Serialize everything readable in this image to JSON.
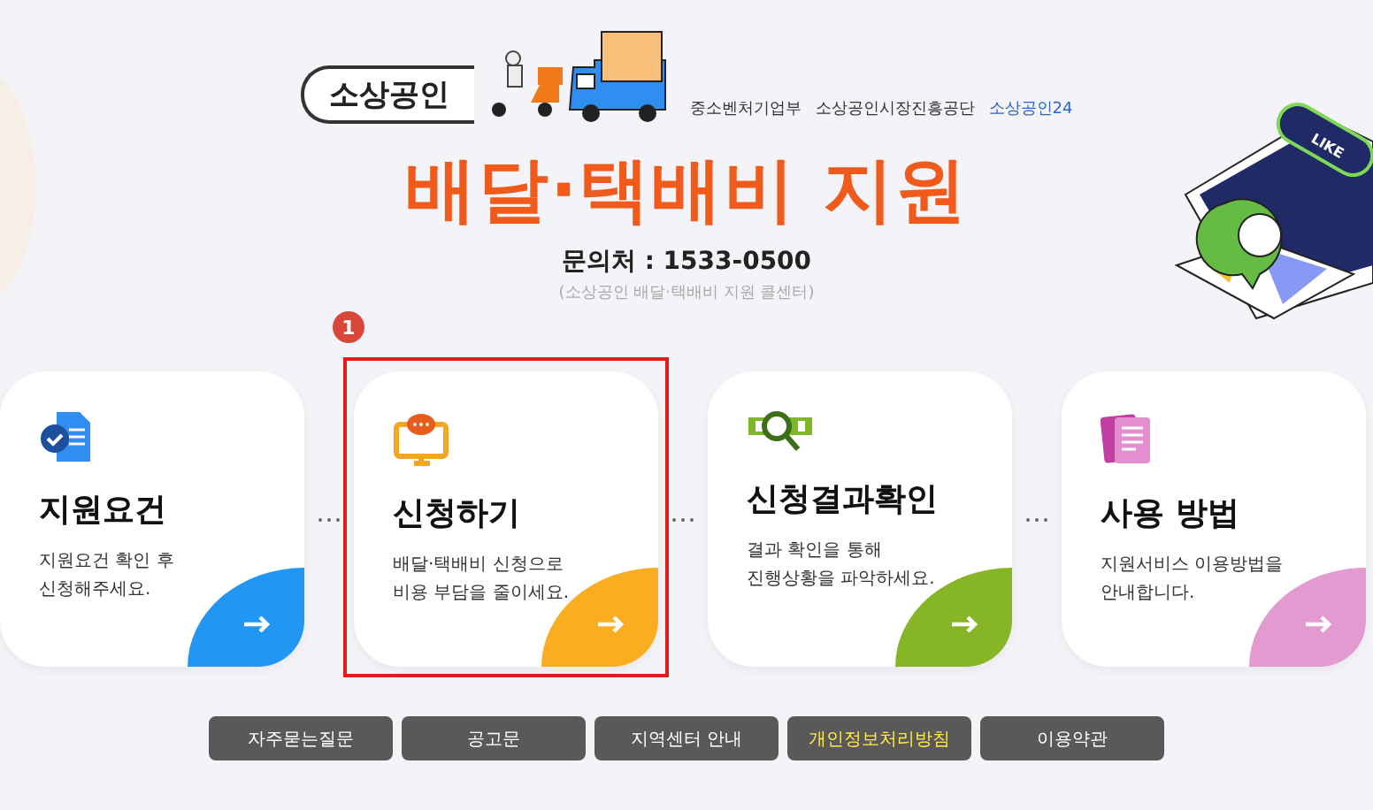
{
  "header": {
    "logo_text": "소상공인",
    "orgs": [
      "중소벤처기업부",
      "소상공인시장진흥공단",
      "소상공인24"
    ],
    "title": "배달·택배비 지원",
    "contact": "문의처 : 1533-0500",
    "contact_note": "(소상공인 배달·택배비 지원 콜센터)",
    "sticker_text": "LIKE"
  },
  "cards": [
    {
      "kind": "document",
      "title": "지원요건",
      "lines": [
        "지원요건 확인 후",
        "신청해주세요."
      ],
      "color": "#2196f3",
      "highlighted": false
    },
    {
      "kind": "monitor",
      "title": "신청하기",
      "lines": [
        "배달·택배비 신청으로",
        "비용 부담을 줄이세요."
      ],
      "color": "#fbad22",
      "highlighted": true,
      "badge": "1"
    },
    {
      "kind": "search",
      "title": "신청결과확인",
      "lines": [
        "결과 확인을 통해",
        "진행상황을 파악하세요."
      ],
      "color": "#86b626",
      "highlighted": false
    },
    {
      "kind": "pages",
      "title": "사용 방법",
      "lines": [
        "지원서비스 이용방법을",
        "안내합니다."
      ],
      "color": "#e39ad0",
      "highlighted": false
    }
  ],
  "footer_links": [
    {
      "label": "자주묻는질문",
      "emphasized": false
    },
    {
      "label": "공고문",
      "emphasized": false
    },
    {
      "label": "지역센터 안내",
      "emphasized": false
    },
    {
      "label": "개인정보처리방침",
      "emphasized": true
    },
    {
      "label": "이용약관",
      "emphasized": false
    }
  ]
}
